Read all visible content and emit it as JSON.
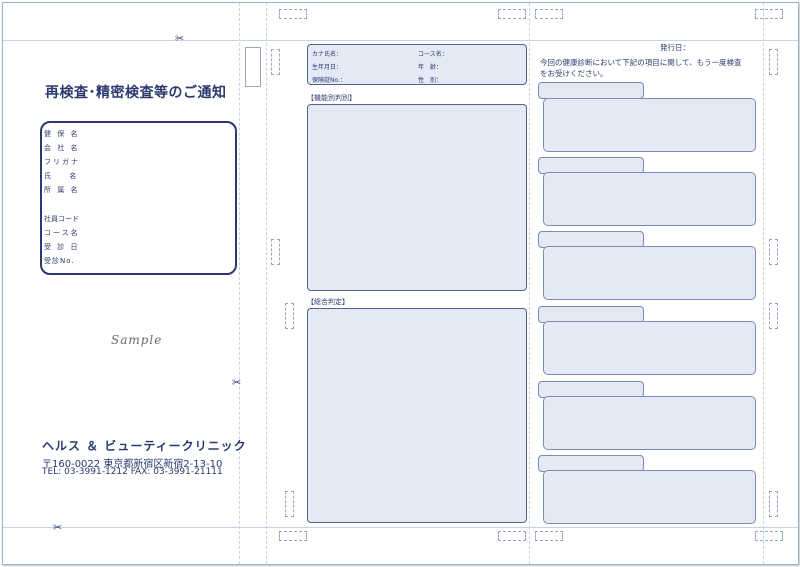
{
  "left": {
    "title": "再検査･精密検査等のご通知",
    "fields": [
      "健 保 名",
      "会 社 名",
      "フリガナ",
      "氏 名",
      "所 属 名",
      "社員コード",
      "コース名",
      "受 診 日",
      "受診No."
    ],
    "sample": "Sample",
    "clinic_name": "ヘルス ＆ ビューティークリニック",
    "address": "〒160-0022 東京都新宿区新宿2-13-10",
    "tel": "TEL: 03-3991-1212 FAX: 03-3991-21111"
  },
  "middle": {
    "header_fields": {
      "kana": "カナ氏名：",
      "course": "コース名：",
      "dob": "生年月日：",
      "age": "年　齢：",
      "insurance": "保険証No.：",
      "gender": "性　別："
    },
    "section1": "【機能別判別】",
    "section2": "【総合判定】"
  },
  "right": {
    "issue_date": "発行日：",
    "notice_line1": "今回の健康診断において下記の項目に関して、もう一度検査",
    "notice_line2": "をお受けください。"
  },
  "icons": {
    "scissors": "✂"
  }
}
